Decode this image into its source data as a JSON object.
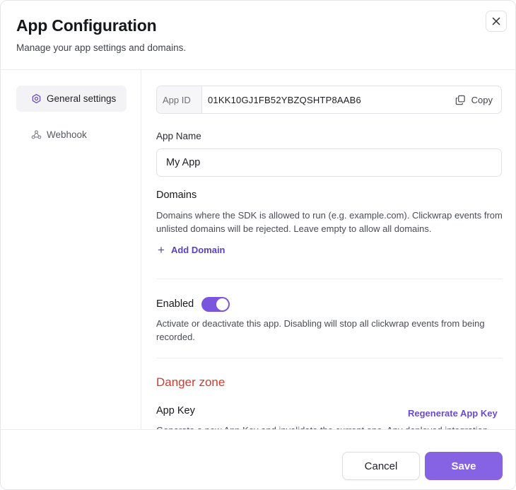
{
  "header": {
    "title": "App Configuration",
    "subtitle": "Manage your app settings and domains.",
    "close_icon": "close-icon"
  },
  "sidebar": {
    "items": [
      {
        "label": "General settings",
        "icon": "gear-icon",
        "active": true
      },
      {
        "label": "Webhook",
        "icon": "webhook-icon",
        "active": false
      }
    ]
  },
  "app_id": {
    "label": "App ID",
    "value": "01KK10GJ1FB52YBZQSHTP8AAB6",
    "copy_label": "Copy"
  },
  "app_name": {
    "label": "App Name",
    "value": "My App"
  },
  "domains": {
    "title": "Domains",
    "help": "Domains where the SDK is allowed to run (e.g. example.com). Clickwrap events from unlisted domains will be rejected. Leave empty to allow all domains.",
    "add_label": "Add Domain"
  },
  "enabled": {
    "label": "Enabled",
    "value": true,
    "help": "Activate or deactivate this app. Disabling will stop all clickwrap events from being recorded."
  },
  "danger_zone": {
    "title": "Danger zone",
    "app_key_label": "App Key",
    "regenerate_label": "Regenerate App Key",
    "help_truncated": "Generate a new App Key and invalidate the current one. Any deployed integration"
  },
  "footer": {
    "cancel_label": "Cancel",
    "save_label": "Save"
  },
  "colors": {
    "accent": "#8663e3",
    "link": "#5b3fc4",
    "danger": "#cf3b2c"
  }
}
